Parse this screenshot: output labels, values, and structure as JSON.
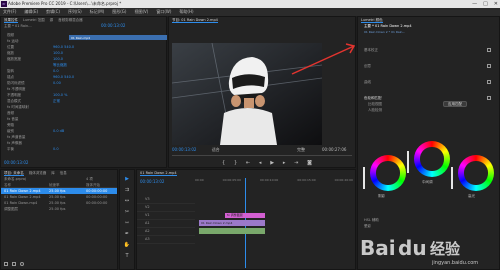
{
  "window": {
    "title": "Adobe Premiere Pro CC 2019 - C:\\Users\\...\\未命名.prproj *",
    "logo": "Pr",
    "controls": [
      "—",
      "□",
      "✕"
    ]
  },
  "menu": [
    "文件(F)",
    "编辑(E)",
    "剪辑(C)",
    "序列(S)",
    "标记(M)",
    "图形(G)",
    "视图(V)",
    "窗口(W)",
    "帮助(H)"
  ],
  "source_panel": {
    "tabs": [
      "效果控件",
      "Lumetri 范围",
      "源",
      "音频剪辑混合器"
    ],
    "clip_label": "主要 * 01 Rain...",
    "timecode": "00:00:13:02",
    "clip_name": "01 Rain.mp4",
    "rows": [
      {
        "label": "视频",
        "value": ""
      },
      {
        "label": "fx 运动",
        "value": ""
      },
      {
        "label": "位置",
        "value": "960.0  540.0"
      },
      {
        "label": "缩放",
        "value": "100.0"
      },
      {
        "label": "缩放宽度",
        "value": "100.0"
      },
      {
        "label": "",
        "value": "等比缩放"
      },
      {
        "label": "旋转",
        "value": "0.0"
      },
      {
        "label": "锚点",
        "value": "960.0  540.0"
      },
      {
        "label": "防闪烁滤镜",
        "value": "0.00"
      },
      {
        "label": "fx 不透明度",
        "value": ""
      },
      {
        "label": "不透明度",
        "value": "100.0 %"
      },
      {
        "label": "混合模式",
        "value": "正常"
      },
      {
        "label": "fx 时间重映射",
        "value": ""
      },
      {
        "label": "音频",
        "value": ""
      },
      {
        "label": "fx 音量",
        "value": ""
      },
      {
        "label": "旁路",
        "value": ""
      },
      {
        "label": "级别",
        "value": "0.0 dB"
      },
      {
        "label": "fx 声道音量",
        "value": ""
      },
      {
        "label": "fx 声像器",
        "value": ""
      },
      {
        "label": "平衡",
        "value": "0.0"
      }
    ],
    "bottom_timecode": "00:00:13:02"
  },
  "program": {
    "tabs": [
      "节目: 01 Rain Down 2.mp4"
    ],
    "timecode_left": "00:00:13:02",
    "fit": "适合",
    "quality": "完整",
    "timecode_right": "00:00:27:06"
  },
  "project": {
    "tabs": [
      "项目: 未命名",
      "媒体浏览器",
      "库",
      "信息"
    ],
    "path": "未命名.prproj",
    "count": "4 项",
    "columns": [
      "名称",
      "帧速率",
      "媒体开始"
    ],
    "items": [
      {
        "name": "01 Rain Down 2.mp4",
        "fps": "25.00 fps",
        "start": "00:00:00:00"
      },
      {
        "name": "01 Rain Down 2.mp4",
        "fps": "25.00 fps",
        "start": "00:00:00:00"
      },
      {
        "name": "01 Rain Down.mp4",
        "fps": "25.00 fps",
        "start": "00:00:00:00"
      },
      {
        "name": "调整图层",
        "fps": "25.00 fps",
        "start": ""
      }
    ]
  },
  "timeline": {
    "tab": "01 Rain Down 2.mp4",
    "timecode": "00:00:13:02",
    "ruler": [
      "00:00",
      "00:00:05:00",
      "00:00:10:00",
      "00:00:15:00",
      "00:00:20:00"
    ],
    "tracks_v": [
      "V3",
      "V2",
      "V1"
    ],
    "tracks_a": [
      "A1",
      "A2",
      "A3"
    ],
    "clips": [
      "fx 调整图层",
      "01 Rain Down 2.mp4",
      ""
    ]
  },
  "lumetri": {
    "title": "Lumetri 颜色",
    "clip": "主要 * 01 Rain Down 2.mp4",
    "seq": "01 Rain Down 2 * 01 Rain...",
    "sections": [
      "基本校正",
      "创意",
      "曲线",
      "色轮和匹配",
      "HSL 辅助",
      "晕影"
    ],
    "compare": "比较视图",
    "wheel_labels": [
      "阴影",
      "中间调",
      "高光"
    ],
    "match": "应用匹配",
    "face_detect": "人脸检测"
  },
  "watermark": {
    "brand": "Bai",
    "paw": "du",
    "suffix": "经验",
    "url": "jingyan.baidu.com"
  }
}
